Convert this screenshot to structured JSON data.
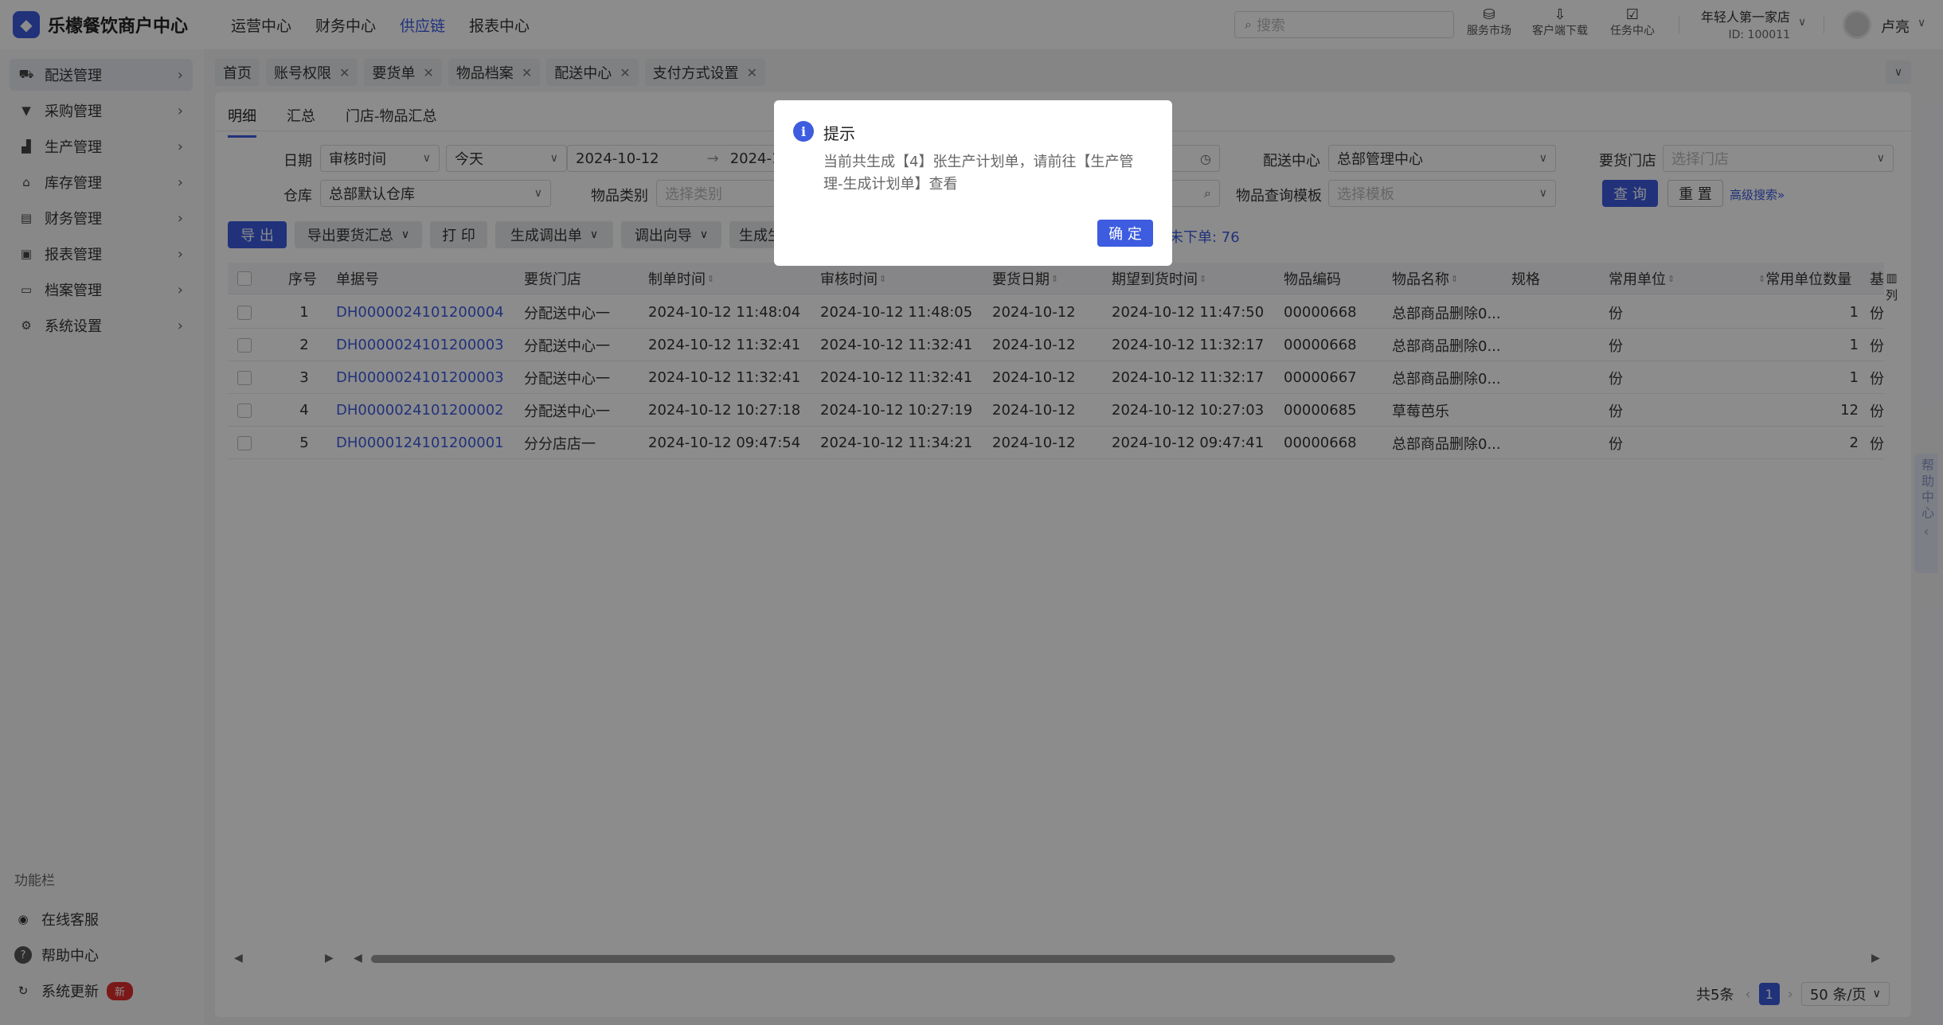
{
  "app": {
    "logo_glyph": "◆",
    "title": "乐檬餐饮商户中心",
    "accent_color": "#3d5ce0"
  },
  "topnav": [
    {
      "label": "运营中心"
    },
    {
      "label": "财务中心"
    },
    {
      "label": "供应链"
    },
    {
      "label": "报表中心"
    }
  ],
  "header": {
    "search_placeholder": "搜索",
    "tools": [
      {
        "label": "服务市场",
        "icon": "shop-icon"
      },
      {
        "label": "客户端下载",
        "icon": "download-icon"
      },
      {
        "label": "任务中心",
        "icon": "task-icon"
      }
    ],
    "shop_name": "年轻人第一家店",
    "shop_id": "ID: 100011",
    "user_name": "卢亮"
  },
  "sidebar": {
    "items": [
      {
        "label": "配送管理",
        "icon": "truck-icon"
      },
      {
        "label": "采购管理",
        "icon": "cart-icon"
      },
      {
        "label": "生产管理",
        "icon": "factory-icon"
      },
      {
        "label": "库存管理",
        "icon": "warehouse-icon"
      },
      {
        "label": "财务管理",
        "icon": "finance-icon"
      },
      {
        "label": "报表管理",
        "icon": "report-icon"
      },
      {
        "label": "档案管理",
        "icon": "archive-icon"
      },
      {
        "label": "系统设置",
        "icon": "gear-icon"
      }
    ],
    "section_label": "功能栏",
    "footer": [
      {
        "label": "在线客服",
        "icon": "headset-icon"
      },
      {
        "label": "帮助中心",
        "icon": "help-icon"
      },
      {
        "label": "系统更新",
        "icon": "refresh-icon",
        "badge": "新"
      }
    ]
  },
  "tabs": [
    {
      "label": "首页",
      "closable": false
    },
    {
      "label": "账号权限",
      "closable": true
    },
    {
      "label": "要货单",
      "closable": true
    },
    {
      "label": "物品档案",
      "closable": true
    },
    {
      "label": "配送中心",
      "closable": true
    },
    {
      "label": "支付方式设置",
      "closable": true
    }
  ],
  "subtabs": [
    "明细",
    "汇总",
    "门店-物品汇总"
  ],
  "filters": {
    "date_label": "日期",
    "date_type": "审核时间",
    "date_range_preset": "今天",
    "date_start": "2024-10-12",
    "date_end_partial": "2024-1",
    "dc_label": "配送中心",
    "dc_value": "总部管理中心",
    "store_label": "要货门店",
    "store_placeholder": "选择门店",
    "warehouse_label": "仓库",
    "warehouse_value": "总部默认仓库",
    "category_label": "物品类别",
    "category_placeholder": "选择类别",
    "template_label": "物品查询模板",
    "template_placeholder": "选择模板",
    "query_btn": "查 询",
    "reset_btn": "重 置",
    "advanced": "高级搜索"
  },
  "toolbar": {
    "export": "导 出",
    "export_summary": "导出要货汇总",
    "print": "打 印",
    "gen_transfer": "生成调出单",
    "transfer_wizard": "调出向导",
    "gen_partial": "生成生",
    "unordered_stat": "未下单: 76"
  },
  "table": {
    "columns": [
      "序号",
      "单据号",
      "要货门店",
      "制单时间",
      "审核时间",
      "要货日期",
      "期望到货时间",
      "物品编码",
      "物品名称",
      "规格",
      "常用单位",
      "常用单位数量",
      "基"
    ],
    "column_settings": "列",
    "rows": [
      {
        "no": "1",
        "doc": "DH0000024101200004",
        "store": "分配送中心一",
        "created": "2024-10-12 11:48:04",
        "audited": "2024-10-12 11:48:05",
        "req_date": "2024-10-12",
        "expected": "2024-10-12 11:47:50",
        "code": "00000668",
        "name": "总部商品删除0...",
        "spec": "",
        "unit": "份",
        "qty": "1",
        "base": "份"
      },
      {
        "no": "2",
        "doc": "DH0000024101200003",
        "store": "分配送中心一",
        "created": "2024-10-12 11:32:41",
        "audited": "2024-10-12 11:32:41",
        "req_date": "2024-10-12",
        "expected": "2024-10-12 11:32:17",
        "code": "00000668",
        "name": "总部商品删除0...",
        "spec": "",
        "unit": "份",
        "qty": "1",
        "base": "份"
      },
      {
        "no": "3",
        "doc": "DH0000024101200003",
        "store": "分配送中心一",
        "created": "2024-10-12 11:32:41",
        "audited": "2024-10-12 11:32:41",
        "req_date": "2024-10-12",
        "expected": "2024-10-12 11:32:17",
        "code": "00000667",
        "name": "总部商品删除0...",
        "spec": "",
        "unit": "份",
        "qty": "1",
        "base": "份"
      },
      {
        "no": "4",
        "doc": "DH0000024101200002",
        "store": "分配送中心一",
        "created": "2024-10-12 10:27:18",
        "audited": "2024-10-12 10:27:19",
        "req_date": "2024-10-12",
        "expected": "2024-10-12 10:27:03",
        "code": "00000685",
        "name": "草莓芭乐",
        "spec": "",
        "unit": "份",
        "qty": "12",
        "base": "份"
      },
      {
        "no": "5",
        "doc": "DH0000124101200001",
        "store": "分分店店一",
        "created": "2024-10-12 09:47:54",
        "audited": "2024-10-12 11:34:21",
        "req_date": "2024-10-12",
        "expected": "2024-10-12 09:47:41",
        "code": "00000668",
        "name": "总部商品删除0...",
        "spec": "",
        "unit": "份",
        "qty": "2",
        "base": "份"
      }
    ]
  },
  "pager": {
    "total": "共5条",
    "current": "1",
    "page_size": "50 条/页"
  },
  "help_float": {
    "label": "帮助中心"
  },
  "modal": {
    "title": "提示",
    "body": "当前共生成【4】张生产计划单，请前往【生产管理-生成计划单】查看",
    "ok": "确 定"
  }
}
